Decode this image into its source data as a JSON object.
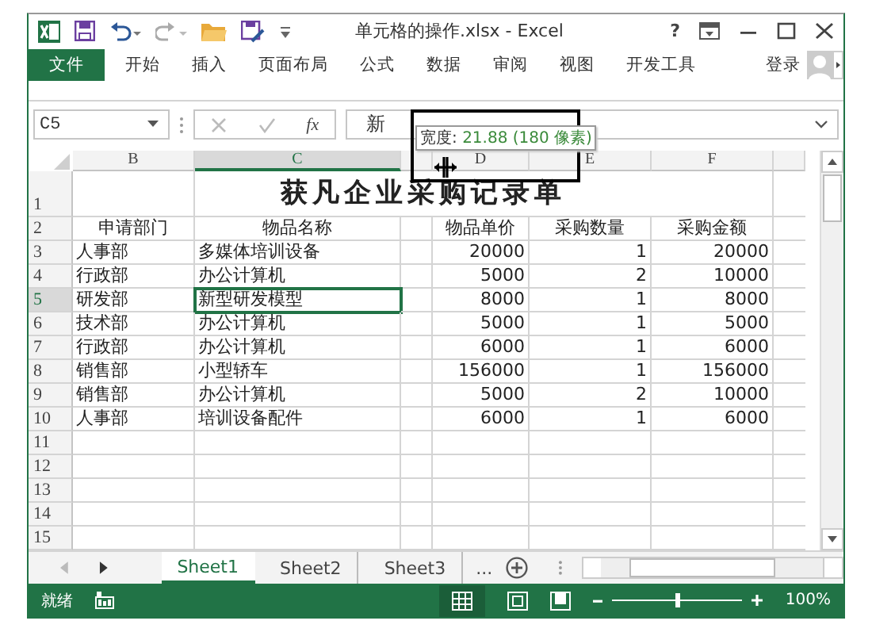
{
  "window": {
    "title": "单元格的操作.xlsx - Excel",
    "help": "?"
  },
  "ribbon_tabs": [
    {
      "label": "文件",
      "selected": true
    },
    {
      "label": "开始",
      "selected": false
    },
    {
      "label": "插入",
      "selected": false
    },
    {
      "label": "页面布局",
      "selected": false
    },
    {
      "label": "公式",
      "selected": false
    },
    {
      "label": "数据",
      "selected": false
    },
    {
      "label": "审阅",
      "selected": false
    },
    {
      "label": "视图",
      "selected": false
    },
    {
      "label": "开发工具",
      "selected": false
    }
  ],
  "sign_in": "登录",
  "formula_bar": {
    "name_box": "C5",
    "function_label": "fx",
    "value": "新"
  },
  "width_tooltip": {
    "label": "宽度:",
    "value": "21.88 (180 像素)"
  },
  "columns": [
    {
      "label": "B",
      "selected": false
    },
    {
      "label": "C",
      "selected": true
    },
    {
      "label": "D",
      "selected": false
    },
    {
      "label": "E",
      "selected": false
    },
    {
      "label": "F",
      "selected": false
    }
  ],
  "rows": [
    {
      "number": "1",
      "kind": "title",
      "selected": false,
      "title": "获凡企业采购记录单"
    },
    {
      "number": "2",
      "kind": "header",
      "selected": false,
      "cells": [
        "申请部门",
        "物品名称",
        "物品单价",
        "采购数量",
        "采购金额"
      ]
    },
    {
      "number": "3",
      "kind": "data",
      "selected": false,
      "cells": [
        "人事部",
        "多媒体培训设备",
        "20000",
        "1",
        "20000"
      ]
    },
    {
      "number": "4",
      "kind": "data",
      "selected": false,
      "cells": [
        "行政部",
        "办公计算机",
        "5000",
        "2",
        "10000"
      ]
    },
    {
      "number": "5",
      "kind": "data",
      "selected": true,
      "cells": [
        "研发部",
        "新型研发模型",
        "8000",
        "1",
        "8000"
      ]
    },
    {
      "number": "6",
      "kind": "data",
      "selected": false,
      "cells": [
        "技术部",
        "办公计算机",
        "5000",
        "1",
        "5000"
      ]
    },
    {
      "number": "7",
      "kind": "data",
      "selected": false,
      "cells": [
        "行政部",
        "办公计算机",
        "6000",
        "1",
        "6000"
      ]
    },
    {
      "number": "8",
      "kind": "data",
      "selected": false,
      "cells": [
        "销售部",
        "小型轿车",
        "156000",
        "1",
        "156000"
      ]
    },
    {
      "number": "9",
      "kind": "data",
      "selected": false,
      "cells": [
        "销售部",
        "办公计算机",
        "5000",
        "2",
        "10000"
      ]
    },
    {
      "number": "10",
      "kind": "data",
      "selected": false,
      "cells": [
        "人事部",
        "培训设备配件",
        "6000",
        "1",
        "6000"
      ]
    },
    {
      "number": "11",
      "kind": "empty",
      "selected": false
    },
    {
      "number": "12",
      "kind": "empty",
      "selected": false
    },
    {
      "number": "13",
      "kind": "empty",
      "selected": false
    },
    {
      "number": "14",
      "kind": "empty",
      "selected": false
    },
    {
      "number": "15",
      "kind": "empty",
      "selected": false
    }
  ],
  "sheet_tabs": [
    {
      "label": "Sheet1",
      "selected": true
    },
    {
      "label": "Sheet2",
      "selected": false
    },
    {
      "label": "Sheet3",
      "selected": false
    }
  ],
  "more_sheets": "...",
  "status_bar": {
    "status": "就绪",
    "zoom": {
      "level": 0.5,
      "reading": "100%"
    }
  }
}
